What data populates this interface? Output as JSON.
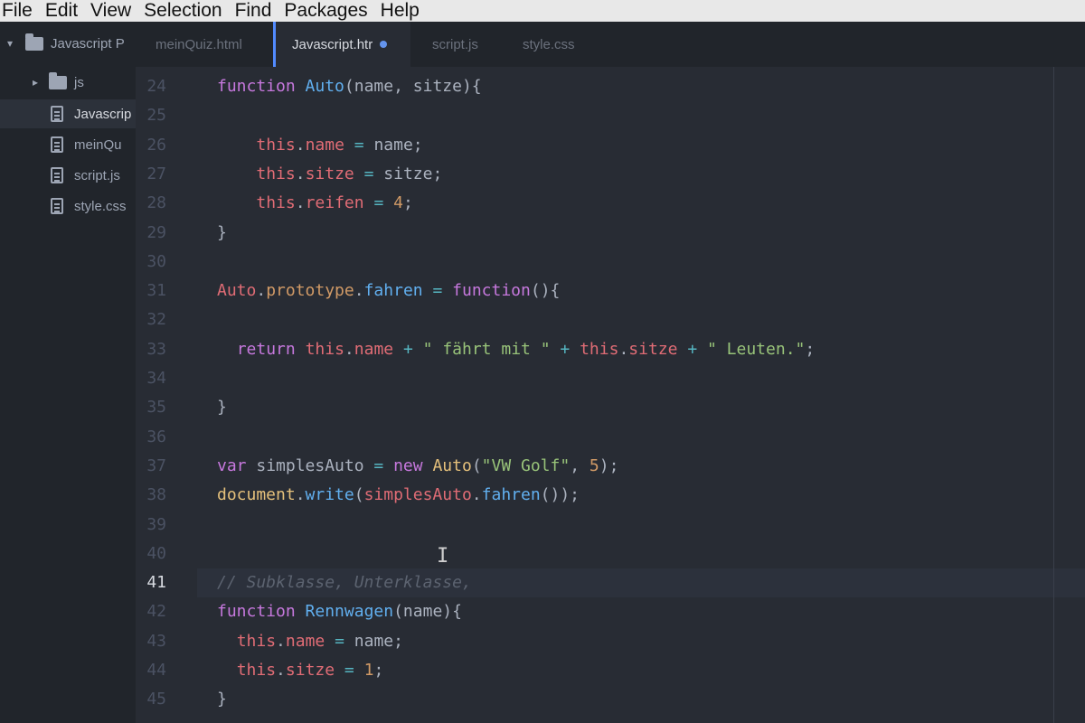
{
  "menu": [
    "File",
    "Edit",
    "View",
    "Selection",
    "Find",
    "Packages",
    "Help"
  ],
  "tree": {
    "project": "Javascript P",
    "folder": "js",
    "files": [
      "Javascrip",
      "meinQu",
      "script.js",
      "style.css"
    ]
  },
  "tabs": [
    {
      "label": "meinQuiz.html"
    },
    {
      "label": "Javascript.htr"
    },
    {
      "label": "script.js"
    },
    {
      "label": "style.css"
    }
  ],
  "icons": {
    "folder": "folder-icon",
    "file": "file-icon",
    "chevron": "chevron-icon",
    "modified": "modified-dot-icon",
    "cursor": "text-cursor-icon"
  },
  "colors": {
    "accent": "#528bff",
    "keyword": "#c678dd",
    "function": "#61afef",
    "this": "#e06c75",
    "string": "#98c379",
    "number": "#d19a66",
    "comment": "#5c6370"
  },
  "editor": {
    "lines": [
      {
        "n": "24",
        "code": [
          {
            "t": "function",
            "c": "kw"
          },
          {
            "t": " "
          },
          {
            "t": "Auto",
            "c": "fn"
          },
          {
            "t": "(name, sitze){"
          }
        ]
      },
      {
        "n": "25",
        "code": []
      },
      {
        "n": "26",
        "code": [
          {
            "t": "    "
          },
          {
            "t": "this",
            "c": "this"
          },
          {
            "t": "."
          },
          {
            "t": "name",
            "c": "prop"
          },
          {
            "t": " "
          },
          {
            "t": "=",
            "c": "op"
          },
          {
            "t": " name;"
          }
        ]
      },
      {
        "n": "27",
        "code": [
          {
            "t": "    "
          },
          {
            "t": "this",
            "c": "this"
          },
          {
            "t": "."
          },
          {
            "t": "sitze",
            "c": "prop"
          },
          {
            "t": " "
          },
          {
            "t": "=",
            "c": "op"
          },
          {
            "t": " sitze;"
          }
        ]
      },
      {
        "n": "28",
        "code": [
          {
            "t": "    "
          },
          {
            "t": "this",
            "c": "this"
          },
          {
            "t": "."
          },
          {
            "t": "reifen",
            "c": "prop"
          },
          {
            "t": " "
          },
          {
            "t": "=",
            "c": "op"
          },
          {
            "t": " "
          },
          {
            "t": "4",
            "c": "num"
          },
          {
            "t": ";"
          }
        ]
      },
      {
        "n": "29",
        "code": [
          {
            "t": "}"
          }
        ]
      },
      {
        "n": "30",
        "code": []
      },
      {
        "n": "31",
        "code": [
          {
            "t": "Auto",
            "c": "this"
          },
          {
            "t": "."
          },
          {
            "t": "prototype",
            "c": "def"
          },
          {
            "t": "."
          },
          {
            "t": "fahren",
            "c": "fn"
          },
          {
            "t": " "
          },
          {
            "t": "=",
            "c": "op"
          },
          {
            "t": " "
          },
          {
            "t": "function",
            "c": "kw"
          },
          {
            "t": "(){"
          }
        ]
      },
      {
        "n": "32",
        "code": []
      },
      {
        "n": "33",
        "code": [
          {
            "t": "  "
          },
          {
            "t": "return",
            "c": "kw"
          },
          {
            "t": " "
          },
          {
            "t": "this",
            "c": "this"
          },
          {
            "t": "."
          },
          {
            "t": "name",
            "c": "prop"
          },
          {
            "t": " "
          },
          {
            "t": "+",
            "c": "op"
          },
          {
            "t": " "
          },
          {
            "t": "\" fährt mit \"",
            "c": "str"
          },
          {
            "t": " "
          },
          {
            "t": "+",
            "c": "op"
          },
          {
            "t": " "
          },
          {
            "t": "this",
            "c": "this"
          },
          {
            "t": "."
          },
          {
            "t": "sitze",
            "c": "prop"
          },
          {
            "t": " "
          },
          {
            "t": "+",
            "c": "op"
          },
          {
            "t": " "
          },
          {
            "t": "\" Leuten.\"",
            "c": "str"
          },
          {
            "t": ";"
          }
        ]
      },
      {
        "n": "34",
        "code": []
      },
      {
        "n": "35",
        "code": [
          {
            "t": "}"
          }
        ]
      },
      {
        "n": "36",
        "code": []
      },
      {
        "n": "37",
        "code": [
          {
            "t": "var",
            "c": "kw"
          },
          {
            "t": " simplesAuto "
          },
          {
            "t": "=",
            "c": "op"
          },
          {
            "t": " "
          },
          {
            "t": "new",
            "c": "kw"
          },
          {
            "t": " "
          },
          {
            "t": "Auto",
            "c": "cls"
          },
          {
            "t": "("
          },
          {
            "t": "\"VW Golf\"",
            "c": "str"
          },
          {
            "t": ", "
          },
          {
            "t": "5",
            "c": "num"
          },
          {
            "t": ");"
          }
        ]
      },
      {
        "n": "38",
        "code": [
          {
            "t": "document",
            "c": "cls"
          },
          {
            "t": "."
          },
          {
            "t": "write",
            "c": "fn"
          },
          {
            "t": "("
          },
          {
            "t": "simplesAuto",
            "c": "this"
          },
          {
            "t": "."
          },
          {
            "t": "fahren",
            "c": "fn"
          },
          {
            "t": "());"
          }
        ]
      },
      {
        "n": "39",
        "code": []
      },
      {
        "n": "40",
        "code": []
      },
      {
        "n": "41",
        "cursor": true,
        "code": [
          {
            "t": "// Subklasse, Unterklasse,",
            "c": "cmt"
          }
        ]
      },
      {
        "n": "42",
        "code": [
          {
            "t": "function",
            "c": "kw"
          },
          {
            "t": " "
          },
          {
            "t": "Rennwagen",
            "c": "fn"
          },
          {
            "t": "(name){"
          }
        ]
      },
      {
        "n": "43",
        "code": [
          {
            "t": "  "
          },
          {
            "t": "this",
            "c": "this"
          },
          {
            "t": "."
          },
          {
            "t": "name",
            "c": "prop"
          },
          {
            "t": " "
          },
          {
            "t": "=",
            "c": "op"
          },
          {
            "t": " name;"
          }
        ]
      },
      {
        "n": "44",
        "code": [
          {
            "t": "  "
          },
          {
            "t": "this",
            "c": "this"
          },
          {
            "t": "."
          },
          {
            "t": "sitze",
            "c": "prop"
          },
          {
            "t": " "
          },
          {
            "t": "=",
            "c": "op"
          },
          {
            "t": " "
          },
          {
            "t": "1",
            "c": "num"
          },
          {
            "t": ";"
          }
        ]
      },
      {
        "n": "45",
        "code": [
          {
            "t": "}"
          }
        ]
      }
    ]
  }
}
